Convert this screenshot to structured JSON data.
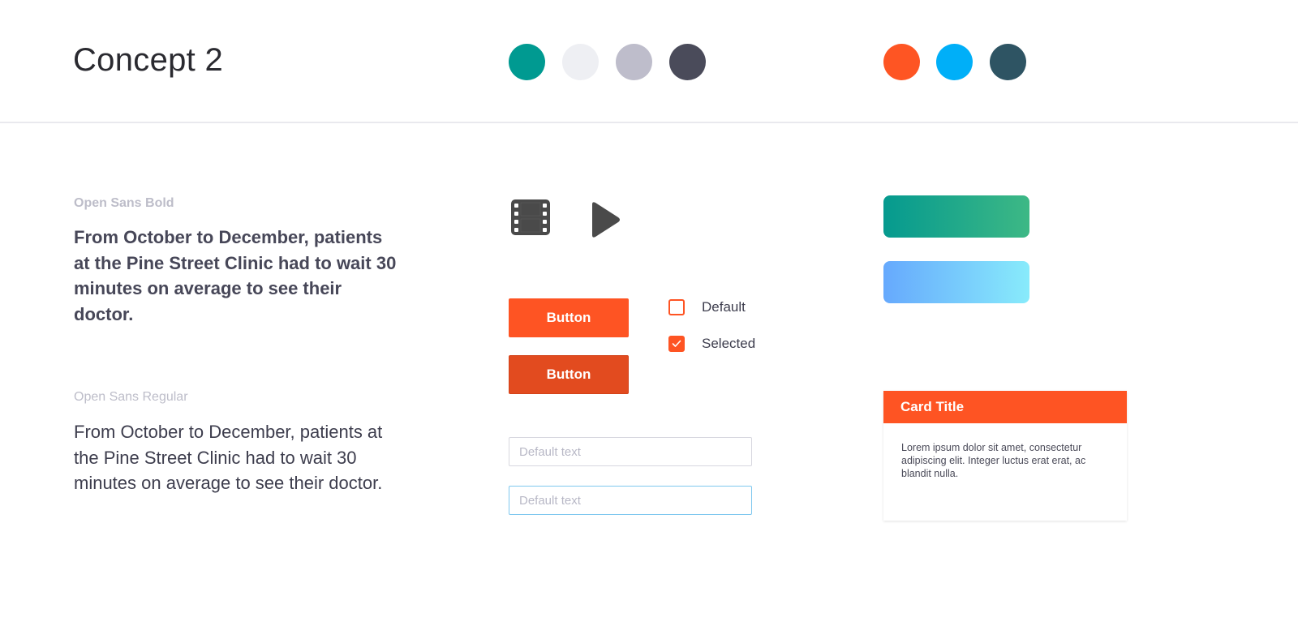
{
  "header": {
    "title": "Concept 2",
    "palette": [
      {
        "name": "teal",
        "color": "#009a91"
      },
      {
        "name": "light-gray",
        "color": "#eeeff3"
      },
      {
        "name": "mid-gray",
        "color": "#bebdcb"
      },
      {
        "name": "dark-gray",
        "color": "#4a4b5a"
      }
    ],
    "accents": [
      {
        "name": "orange",
        "color": "#fe5523"
      },
      {
        "name": "sky-blue",
        "color": "#00aff8"
      },
      {
        "name": "slate-blue",
        "color": "#2e5463"
      }
    ]
  },
  "typography": {
    "bold_caption": "Open Sans Bold",
    "bold_sample": "From October to December, patients at the Pine Street Clinic had to wait 30 minutes on average to see their doctor.",
    "regular_caption": "Open Sans Regular",
    "regular_sample": "From October to December, patients at the Pine Street Clinic had to wait 30 minutes on average to see their doctor."
  },
  "icons": {
    "film": "film-icon",
    "play": "play-icon",
    "color": "#4a4a4a"
  },
  "buttons": {
    "primary_label": "Button",
    "pressed_label": "Button",
    "primary_color": "#fe5423",
    "pressed_color": "#e24b1f"
  },
  "checkboxes": {
    "default_label": "Default",
    "selected_label": "Selected"
  },
  "inputs": {
    "default_placeholder": "Default text",
    "focused_placeholder": "Default text"
  },
  "gradients": [
    {
      "name": "green-gradient",
      "from": "#059a8f",
      "to": "#3db885"
    },
    {
      "name": "blue-gradient",
      "from": "#66a9fd",
      "to": "#88ebfb"
    }
  ],
  "card": {
    "title": "Card Title",
    "body": "Lorem ipsum dolor sit amet, consectetur adipiscing elit. Integer luctus erat erat, ac blandit nulla."
  }
}
